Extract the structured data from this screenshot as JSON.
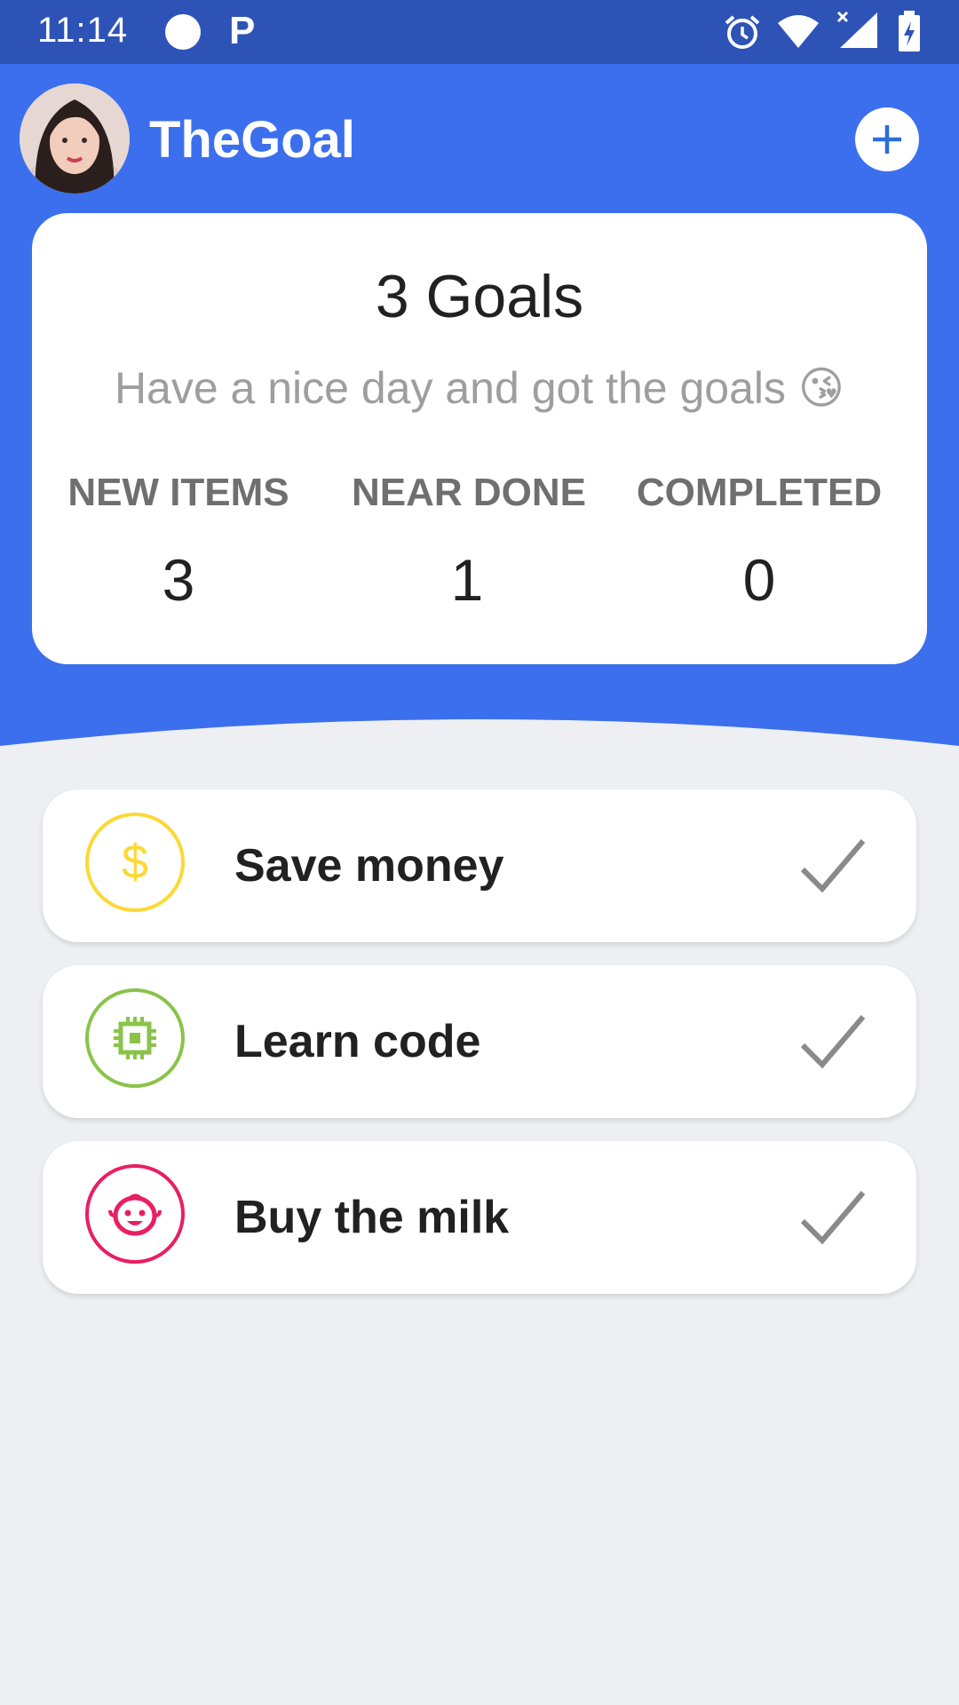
{
  "status_bar": {
    "time": "11:14",
    "app_letter": "P"
  },
  "header": {
    "app_title": "TheGoal",
    "add_icon": "plus-icon"
  },
  "summary": {
    "title": "3 Goals",
    "subtitle": "Have a nice day and got the goals 😘",
    "stats": [
      {
        "label": "NEW ITEMS",
        "value": "3"
      },
      {
        "label": "NEAR DONE",
        "value": "1"
      },
      {
        "label": "COMPLETED",
        "value": "0"
      }
    ]
  },
  "goals": [
    {
      "label": "Save money",
      "icon": "dollar-icon",
      "color": "#fdd835"
    },
    {
      "label": "Learn code",
      "icon": "chip-icon",
      "color": "#8bc34a"
    },
    {
      "label": "Buy the milk",
      "icon": "baby-face-icon",
      "color": "#e91e63"
    }
  ],
  "colors": {
    "status_bar": "#2e53b7",
    "primary": "#3b6fee",
    "background": "#eeeff2",
    "check": "#8a8a8a"
  }
}
